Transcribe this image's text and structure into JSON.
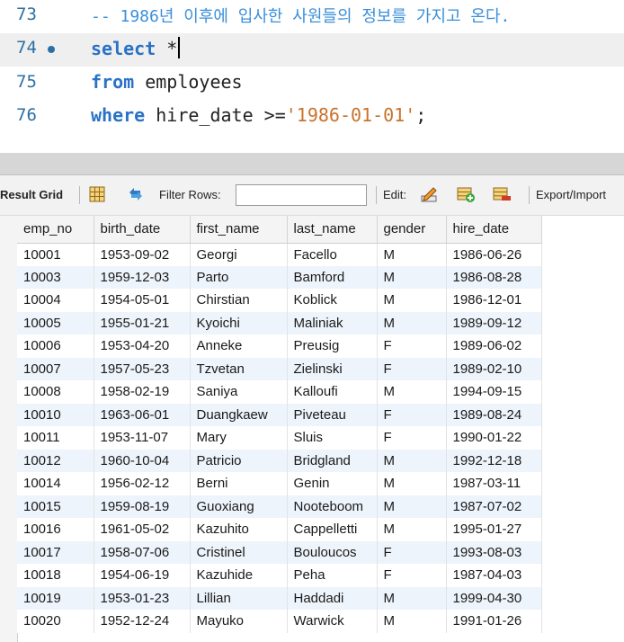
{
  "editor": {
    "lines": [
      {
        "number": "73",
        "comment": "-- 1986년 이후에 입사한 사원들의 정보를 가지고 온다."
      },
      {
        "number": "74",
        "keyword": "select",
        "rest": " *"
      },
      {
        "number": "75",
        "keyword": "from",
        "rest": " employees"
      },
      {
        "number": "76",
        "keyword": "where",
        "rest": " hire_date >=",
        "string": "'1986-01-01'",
        "tail": ";"
      }
    ]
  },
  "toolbar": {
    "result_grid_label": "Result Grid",
    "filter_rows_label": "Filter Rows:",
    "filter_value": "",
    "edit_label": "Edit:",
    "export_label": "Export/Import"
  },
  "grid": {
    "columns": [
      "emp_no",
      "birth_date",
      "first_name",
      "last_name",
      "gender",
      "hire_date"
    ],
    "rows": [
      [
        "10001",
        "1953-09-02",
        "Georgi",
        "Facello",
        "M",
        "1986-06-26"
      ],
      [
        "10003",
        "1959-12-03",
        "Parto",
        "Bamford",
        "M",
        "1986-08-28"
      ],
      [
        "10004",
        "1954-05-01",
        "Chirstian",
        "Koblick",
        "M",
        "1986-12-01"
      ],
      [
        "10005",
        "1955-01-21",
        "Kyoichi",
        "Maliniak",
        "M",
        "1989-09-12"
      ],
      [
        "10006",
        "1953-04-20",
        "Anneke",
        "Preusig",
        "F",
        "1989-06-02"
      ],
      [
        "10007",
        "1957-05-23",
        "Tzvetan",
        "Zielinski",
        "F",
        "1989-02-10"
      ],
      [
        "10008",
        "1958-02-19",
        "Saniya",
        "Kalloufi",
        "M",
        "1994-09-15"
      ],
      [
        "10010",
        "1963-06-01",
        "Duangkaew",
        "Piveteau",
        "F",
        "1989-08-24"
      ],
      [
        "10011",
        "1953-11-07",
        "Mary",
        "Sluis",
        "F",
        "1990-01-22"
      ],
      [
        "10012",
        "1960-10-04",
        "Patricio",
        "Bridgland",
        "M",
        "1992-12-18"
      ],
      [
        "10014",
        "1956-02-12",
        "Berni",
        "Genin",
        "M",
        "1987-03-11"
      ],
      [
        "10015",
        "1959-08-19",
        "Guoxiang",
        "Nooteboom",
        "M",
        "1987-07-02"
      ],
      [
        "10016",
        "1961-05-02",
        "Kazuhito",
        "Cappelletti",
        "M",
        "1995-01-27"
      ],
      [
        "10017",
        "1958-07-06",
        "Cristinel",
        "Bouloucos",
        "F",
        "1993-08-03"
      ],
      [
        "10018",
        "1954-06-19",
        "Kazuhide",
        "Peha",
        "F",
        "1987-04-03"
      ],
      [
        "10019",
        "1953-01-23",
        "Lillian",
        "Haddadi",
        "M",
        "1999-04-30"
      ],
      [
        "10020",
        "1952-12-24",
        "Mayuko",
        "Warwick",
        "M",
        "1991-01-26"
      ]
    ]
  }
}
